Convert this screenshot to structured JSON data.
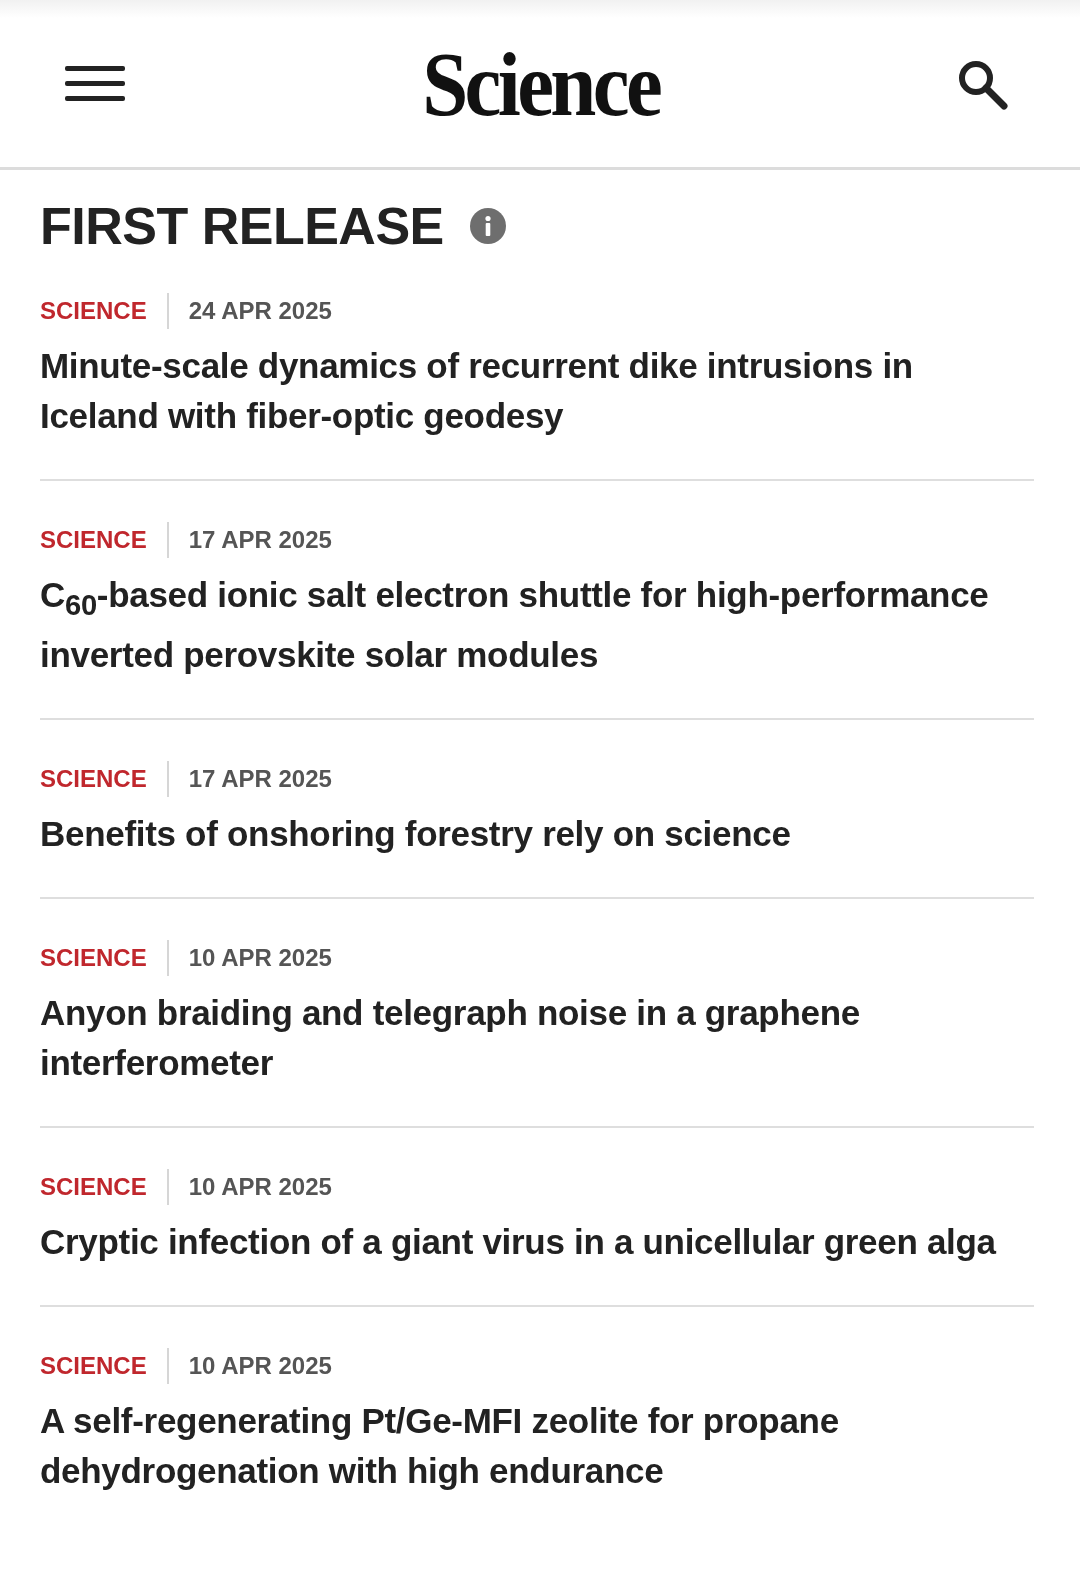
{
  "header": {
    "logo": "Science"
  },
  "section": {
    "title": "FIRST RELEASE"
  },
  "articles": [
    {
      "source": "SCIENCE",
      "date": "24 APR 2025",
      "title": "Minute-scale dynamics of recurrent dike intrusions in Iceland with fiber-optic geodesy"
    },
    {
      "source": "SCIENCE",
      "date": "17 APR 2025",
      "title": "C$_{60}$-based ionic salt electron shuttle for high-performance inverted perovskite solar modules"
    },
    {
      "source": "SCIENCE",
      "date": "17 APR 2025",
      "title": "Benefits of onshoring forestry rely on science"
    },
    {
      "source": "SCIENCE",
      "date": "10 APR 2025",
      "title": "Anyon braiding and telegraph noise in a graphene interferometer"
    },
    {
      "source": "SCIENCE",
      "date": "10 APR 2025",
      "title": "Cryptic infection of a giant virus in a unicellular green alga"
    },
    {
      "source": "SCIENCE",
      "date": "10 APR 2025",
      "title": "A self-regenerating Pt/Ge-MFI zeolite for propane dehydrogenation with high endurance"
    }
  ]
}
